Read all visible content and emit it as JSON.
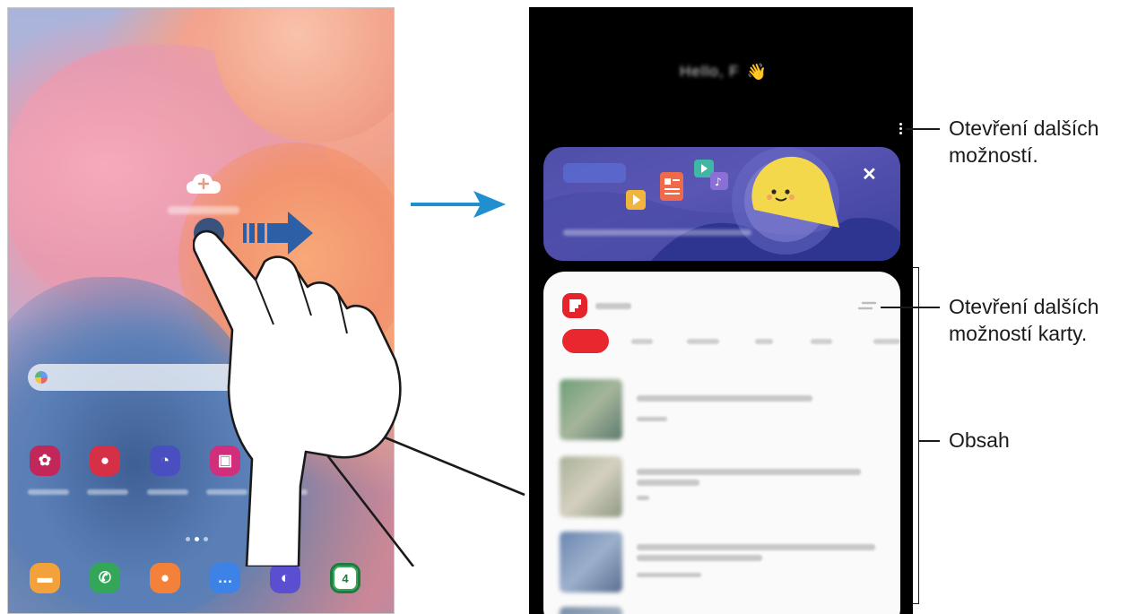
{
  "left_panel": {
    "apps_row": [
      {
        "icon": "gallery-icon",
        "color": "#c2275a",
        "glyph": "✿"
      },
      {
        "icon": "camera-icon",
        "color": "#d63046",
        "glyph": "●"
      },
      {
        "icon": "clock-icon",
        "color": "#4a4fc0",
        "glyph": "◔"
      },
      {
        "icon": "store-icon",
        "color": "#d12f7c",
        "glyph": "▣"
      },
      {
        "icon": "play-store-icon",
        "color": "#ffffff",
        "glyph": "▶"
      }
    ],
    "dock": [
      {
        "icon": "files-icon",
        "color": "#f3a13a",
        "glyph": "▬"
      },
      {
        "icon": "phone-icon",
        "color": "#34a65a",
        "glyph": "✆"
      },
      {
        "icon": "contacts-icon",
        "color": "#f3813a",
        "glyph": "●"
      },
      {
        "icon": "messages-icon",
        "color": "#3d82e6",
        "glyph": "…"
      },
      {
        "icon": "internet-icon",
        "color": "#5b4fd1",
        "glyph": "◐"
      },
      {
        "icon": "calendar-icon",
        "color": "#34a65a",
        "glyph": "4"
      }
    ]
  },
  "right_panel": {
    "greeting_wave": "👋",
    "banner": {
      "close_label": "✕"
    }
  },
  "callouts": {
    "more_options": [
      "Otevření dalších",
      "možností."
    ],
    "card_options": [
      "Otevření dalších",
      "možností karty."
    ],
    "content": "Obsah"
  },
  "colors": {
    "arrow_blue": "#1f8fd0",
    "flipboard_red": "#e4232a"
  }
}
